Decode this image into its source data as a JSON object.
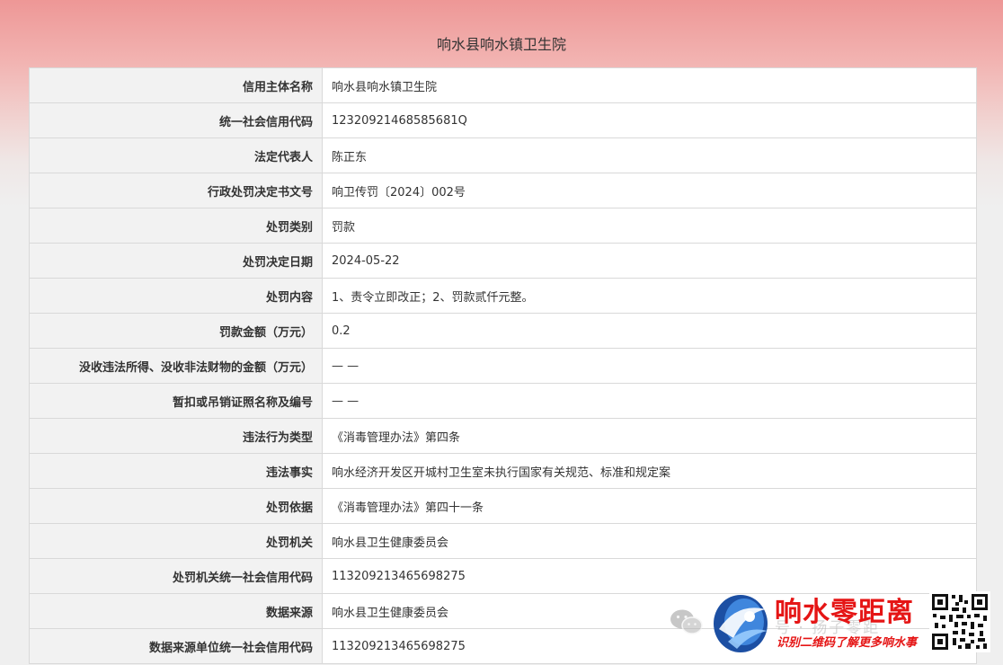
{
  "page": {
    "title": "响水县响水镇卫生院"
  },
  "rows": [
    {
      "label": "信用主体名称",
      "value": "响水县响水镇卫生院"
    },
    {
      "label": "统一社会信用代码",
      "value": "12320921468585681Q"
    },
    {
      "label": "法定代表人",
      "value": "陈正东"
    },
    {
      "label": "行政处罚决定书文号",
      "value": "响卫传罚〔2024〕002号"
    },
    {
      "label": "处罚类别",
      "value": "罚款"
    },
    {
      "label": "处罚决定日期",
      "value": "2024-05-22"
    },
    {
      "label": "处罚内容",
      "value": "1、责令立即改正；2、罚款贰仟元整。"
    },
    {
      "label": "罚款金额（万元）",
      "value": "0.2"
    },
    {
      "label": "没收违法所得、没收非法财物的金额（万元）",
      "value": "— —"
    },
    {
      "label": "暂扣或吊销证照名称及编号",
      "value": "— —"
    },
    {
      "label": "违法行为类型",
      "value": "《消毒管理办法》第四条"
    },
    {
      "label": "违法事实",
      "value": "响水经济开发区开城村卫生室未执行国家有关规范、标准和规定案"
    },
    {
      "label": "处罚依据",
      "value": "《消毒管理办法》第四十一条"
    },
    {
      "label": "处罚机关",
      "value": "响水县卫生健康委员会"
    },
    {
      "label": "处罚机关统一社会信用代码",
      "value": "113209213465698275"
    },
    {
      "label": "数据来源",
      "value": "响水县卫生健康委员会"
    },
    {
      "label": "数据来源单位统一社会信用代码",
      "value": "113209213465698275"
    }
  ],
  "watermark": {
    "brand_name": "响水零距离",
    "tagline": "识别二维码了解更多响水事",
    "ghost_text": "号 · 扬子零距",
    "brand_color": "#e51515",
    "icons": [
      "wechat-icon",
      "logo-icon",
      "qr-code"
    ]
  }
}
